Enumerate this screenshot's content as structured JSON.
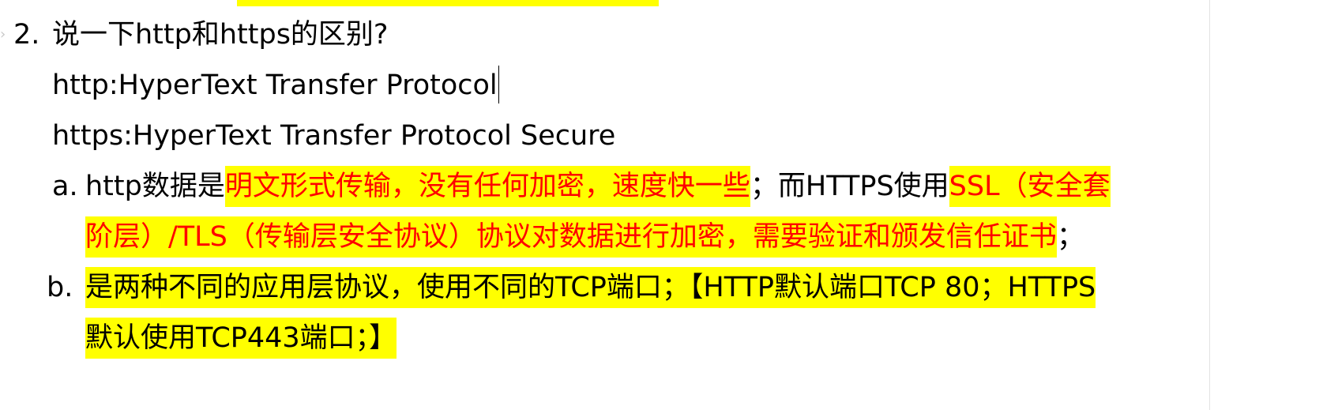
{
  "question": {
    "number": "2.",
    "text": "说一下http和https的区别?"
  },
  "definitions": {
    "http": "http:HyperText Transfer Protocol",
    "https": "https:HyperText  Transfer Protocol Secure"
  },
  "items": [
    {
      "marker": "a.",
      "line1": {
        "prefix": "http数据是",
        "red_highlight_1": "明文形式传输，没有任何加密，速度快一些",
        "middle": "；而HTTPS使用",
        "red_highlight_2": "SSL（安全套"
      },
      "line2": {
        "red_highlight": "阶层）/TLS（传输层安全协议）协议对数据进行加密，需要验证和颁发信任证书",
        "suffix": "；"
      }
    },
    {
      "marker": "b.",
      "line1": "是两种不同的应用层协议，使用不同的TCP端口；【HTTP默认端口TCP 80；HTTPS",
      "line2": "默认使用TCP443端口；】"
    }
  ],
  "colors": {
    "highlight": "#ffff00",
    "red_text": "#ff0000",
    "body_text": "#000000"
  }
}
